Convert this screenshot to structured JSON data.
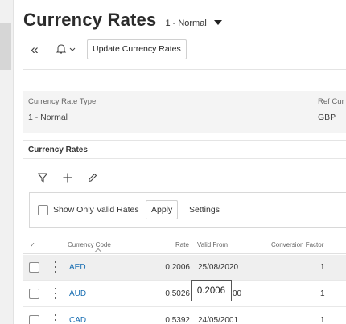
{
  "page": {
    "title": "Currency Rates",
    "rate_type_selector": "1 - Normal"
  },
  "toolbar": {
    "collapse_icon": "double-chevron-left-icon",
    "notification_icon": "bell-icon",
    "update_button": "Update Currency Rates"
  },
  "header_fields": {
    "currency_rate_type_label": "Currency Rate Type",
    "currency_rate_type_value": "1 - Normal",
    "ref_currency_label": "Ref Cur",
    "ref_currency_value": "GBP"
  },
  "list": {
    "title": "Currency Rates",
    "tools": [
      "filter-icon",
      "plus-icon",
      "pencil-icon"
    ],
    "filter_bar": {
      "valid_only_label": "Show Only Valid Rates",
      "valid_only_checked": false,
      "apply_button": "Apply",
      "settings_link": "Settings"
    },
    "columns": {
      "select_all": "✓",
      "currency_code": "Currency Code",
      "rate": "Rate",
      "valid_from": "Valid From",
      "conversion_factor": "Conversion Factor"
    },
    "rows": [
      {
        "code": "AED",
        "rate": "0.2006",
        "valid_from": "25/08/2020",
        "factor": "1",
        "selected": true
      },
      {
        "code": "AUD",
        "rate": "0.5026",
        "valid_from": "00",
        "factor": "1",
        "selected": false
      },
      {
        "code": "CAD",
        "rate": "0.5392",
        "valid_from": "24/05/2001",
        "factor": "1",
        "selected": false
      }
    ],
    "tooltip": "0.2006"
  },
  "colors": {
    "link": "#1a6fb3",
    "selected_row": "#efefef",
    "panel_grey": "#f4f4f4"
  }
}
